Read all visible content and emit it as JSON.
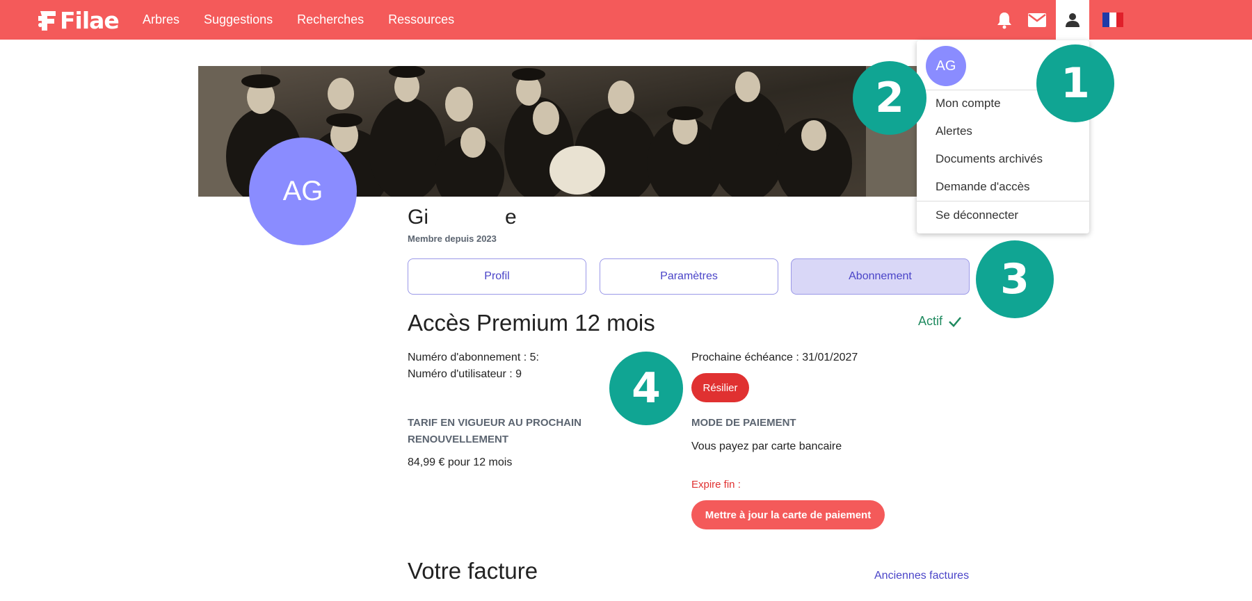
{
  "brand": {
    "name": "Filae",
    "accent": "#f45a5a",
    "primary": "#4a44c8",
    "badge_color": "#10a593"
  },
  "nav": {
    "links": [
      "Arbres",
      "Suggestions",
      "Recherches",
      "Ressources"
    ],
    "icons": [
      "bell-icon",
      "mail-icon",
      "user-icon",
      "french-flag-icon"
    ]
  },
  "profile": {
    "initials": "AG",
    "name_visible_start": "Gi",
    "name_visible_end": "e",
    "member_since": "Membre depuis 2023"
  },
  "tabs": [
    {
      "label": "Profil",
      "selected": false
    },
    {
      "label": "Paramètres",
      "selected": false
    },
    {
      "label": "Abonnement",
      "selected": true
    }
  ],
  "subscription": {
    "title": "Accès Premium 12 mois",
    "status": "Actif",
    "subscription_number": "Numéro d'abonnement : 5:",
    "user_number": "Numéro d'utilisateur : 9",
    "next_due": "Prochaine échéance : 31/01/2027",
    "cancel_label": "Résilier",
    "tariff_heading": "TARIF EN VIGUEUR AU PROCHAIN RENOUVELLEMENT",
    "tariff_value": "84,99 € pour 12 mois",
    "payment_heading": "MODE DE PAIEMENT",
    "payment_text": "Vous payez par carte bancaire",
    "expire_label": "Expire fin :",
    "update_card_label": "Mettre à jour la carte de paiement"
  },
  "invoice": {
    "title": "Votre facture",
    "old_invoices_label": "Anciennes factures"
  },
  "user_menu": {
    "initials": "AG",
    "items": [
      "Mon compte",
      "Alertes",
      "Documents archivés",
      "Demande d'accès"
    ],
    "logout": "Se déconnecter"
  },
  "callouts": [
    "1",
    "2",
    "3",
    "4"
  ]
}
